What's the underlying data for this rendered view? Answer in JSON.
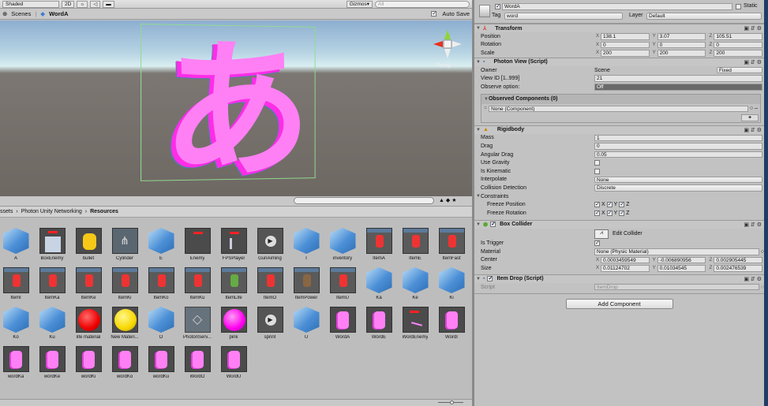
{
  "scene_toolbar": {
    "shading": "Shaded",
    "mode_2d": "2D",
    "gizmos": "Gizmos",
    "search_placeholder": "All"
  },
  "scene_tabs": {
    "scenes": "Scenes",
    "current": "WordA",
    "auto_save": "Auto Save"
  },
  "viewport": {
    "object_glyph": "あ",
    "projection": "Persp"
  },
  "project": {
    "breadcrumb": [
      "ssets",
      "Photon Unity Networking",
      "Resources"
    ],
    "items": [
      {
        "name": "A",
        "type": "cube"
      },
      {
        "name": "BoxEnemy",
        "type": "box"
      },
      {
        "name": "bullet",
        "type": "yellow-cyl"
      },
      {
        "name": "Cylinder",
        "type": "mesh"
      },
      {
        "name": "E",
        "type": "cube"
      },
      {
        "name": "Enemy",
        "type": "enemy"
      },
      {
        "name": "FPSPlayer",
        "type": "player"
      },
      {
        "name": "GunAiming",
        "type": "anim"
      },
      {
        "name": "I",
        "type": "cube"
      },
      {
        "name": "inventory",
        "type": "cube"
      },
      {
        "name": "ItemA",
        "type": "item"
      },
      {
        "name": "ItemE",
        "type": "item"
      },
      {
        "name": "ItemFast",
        "type": "item"
      },
      {
        "name": "ItemI",
        "type": "item"
      },
      {
        "name": "ItemKa",
        "type": "item"
      },
      {
        "name": "ItemKe",
        "type": "item"
      },
      {
        "name": "ItemKi",
        "type": "item"
      },
      {
        "name": "ItemKo",
        "type": "item"
      },
      {
        "name": "ItemKu",
        "type": "item"
      },
      {
        "name": "ItemLife",
        "type": "item-green"
      },
      {
        "name": "ItemO",
        "type": "item"
      },
      {
        "name": "ItemPower",
        "type": "item-brown"
      },
      {
        "name": "ItemU",
        "type": "item"
      },
      {
        "name": "Ka",
        "type": "cube"
      },
      {
        "name": "Ke",
        "type": "cube"
      },
      {
        "name": "Ki",
        "type": "cube"
      },
      {
        "name": "Ko",
        "type": "cube"
      },
      {
        "name": "Ku",
        "type": "cube"
      },
      {
        "name": "life material",
        "type": "sphere-red"
      },
      {
        "name": "New Materi...",
        "type": "sphere-yellow"
      },
      {
        "name": "O",
        "type": "cube"
      },
      {
        "name": "PhotonServ...",
        "type": "unity"
      },
      {
        "name": "pink",
        "type": "sphere-pink"
      },
      {
        "name": "sprint",
        "type": "anim"
      },
      {
        "name": "U",
        "type": "cube"
      },
      {
        "name": "WordA",
        "type": "word"
      },
      {
        "name": "WordE",
        "type": "word"
      },
      {
        "name": "WordEnemy",
        "type": "word-enemy"
      },
      {
        "name": "WordI",
        "type": "word"
      },
      {
        "name": "wordKa",
        "type": "word"
      },
      {
        "name": "wordKe",
        "type": "word"
      },
      {
        "name": "wordKi",
        "type": "word"
      },
      {
        "name": "wordKo",
        "type": "word"
      },
      {
        "name": "wordKu",
        "type": "word"
      },
      {
        "name": "WordO",
        "type": "word"
      },
      {
        "name": "WordU",
        "type": "word"
      }
    ]
  },
  "inspector": {
    "name": "WordA",
    "static_label": "Static",
    "tag_label": "Tag",
    "tag": "word",
    "layer_label": "Layer",
    "layer": "Default",
    "transform": {
      "title": "Transform",
      "rows": [
        {
          "label": "Position",
          "x": "138.1",
          "y": "3.07",
          "z": "105.51"
        },
        {
          "label": "Rotation",
          "x": "0",
          "y": "0",
          "z": "0"
        },
        {
          "label": "Scale",
          "x": "200",
          "y": "200",
          "z": "200"
        }
      ]
    },
    "photon": {
      "title": "Photon View (Script)",
      "owner_label": "Owner",
      "owner": "Scene",
      "owner_mode": "Fixed",
      "viewid_label": "View ID [1..999]",
      "viewid": "21",
      "observe_label": "Observe option:",
      "observe": "Off",
      "observed_title": "Observed Components (0)",
      "observed_item": "None (Component)",
      "add": "+"
    },
    "rigidbody": {
      "title": "Rigidbody",
      "mass_label": "Mass",
      "mass": "1",
      "drag_label": "Drag",
      "drag": "0",
      "adrag_label": "Angular Drag",
      "adrag": "0.05",
      "gravity_label": "Use Gravity",
      "kinematic_label": "Is Kinematic",
      "interp_label": "Interpolate",
      "interp": "None",
      "coll_label": "Collision Detection",
      "coll": "Discrete",
      "constraints": "Constraints",
      "fpos": "Freeze Position",
      "frot": "Freeze Rotation"
    },
    "box": {
      "title": "Box Collider",
      "edit": "Edit Collider",
      "trigger_label": "Is Trigger",
      "material_label": "Material",
      "material": "None (Physic Material)",
      "center_label": "Center",
      "cx": "0.0003459549",
      "cy": "-0.006890956",
      "cz": "0.002905445",
      "size_label": "Size",
      "sx": "0.01124702",
      "sy": "0.01034545",
      "sz": "0.002476539"
    },
    "itemdrop": {
      "title": "Item Drop (Script)",
      "script_label": "Script",
      "script": "ItemDrop"
    },
    "add_component": "Add Component"
  }
}
